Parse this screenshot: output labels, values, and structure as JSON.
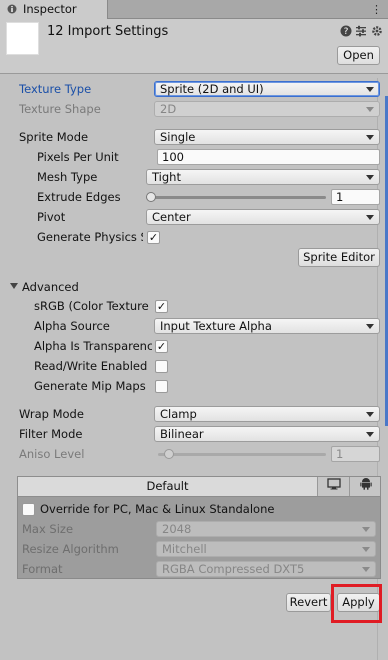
{
  "window": {
    "tab_title": "Inspector",
    "tab_icon": "info-icon",
    "menu_icon": "kebab-menu-icon"
  },
  "header": {
    "title": "12 Import Settings",
    "open_button": "Open",
    "help_icon": "help-icon",
    "preset_icon": "sliders-icon",
    "settings_icon": "gear-icon"
  },
  "fields": {
    "texture_type": {
      "label": "Texture Type",
      "value": "Sprite (2D and UI)"
    },
    "texture_shape": {
      "label": "Texture Shape",
      "value": "2D"
    },
    "sprite_mode": {
      "label": "Sprite Mode",
      "value": "Single"
    },
    "pixels_per_unit": {
      "label": "Pixels Per Unit",
      "value": "100"
    },
    "mesh_type": {
      "label": "Mesh Type",
      "value": "Tight"
    },
    "extrude_edges": {
      "label": "Extrude Edges",
      "value": "1",
      "level": 0
    },
    "pivot": {
      "label": "Pivot",
      "value": "Center"
    },
    "generate_physics": {
      "label": "Generate Physics S",
      "checked": true
    },
    "sprite_editor_button": "Sprite Editor"
  },
  "advanced": {
    "label": "Advanced",
    "srgb": {
      "label": "sRGB (Color Texture",
      "checked": true
    },
    "alpha_source": {
      "label": "Alpha Source",
      "value": "Input Texture Alpha"
    },
    "alpha_transparency": {
      "label": "Alpha Is Transparenc",
      "checked": true
    },
    "read_write": {
      "label": "Read/Write Enabled",
      "checked": false
    },
    "mip_maps": {
      "label": "Generate Mip Maps",
      "checked": false
    }
  },
  "wrap_mode": {
    "label": "Wrap Mode",
    "value": "Clamp"
  },
  "filter_mode": {
    "label": "Filter Mode",
    "value": "Bilinear"
  },
  "aniso_level": {
    "label": "Aniso Level",
    "value": "1",
    "level": 0
  },
  "platform": {
    "default_tab": "Default",
    "standalone_icon": "monitor-icon",
    "android_icon": "android-icon",
    "override_label": "Override for PC, Mac & Linux Standalone",
    "max_size": {
      "label": "Max Size",
      "value": "2048"
    },
    "resize_algorithm": {
      "label": "Resize Algorithm",
      "value": "Mitchell"
    },
    "format": {
      "label": "Format",
      "value": "RGBA Compressed DXT5"
    }
  },
  "footer": {
    "revert_button": "Revert",
    "apply_button": "Apply"
  },
  "colors": {
    "highlight": "#e01c24",
    "accent": "#3a6fd0"
  }
}
